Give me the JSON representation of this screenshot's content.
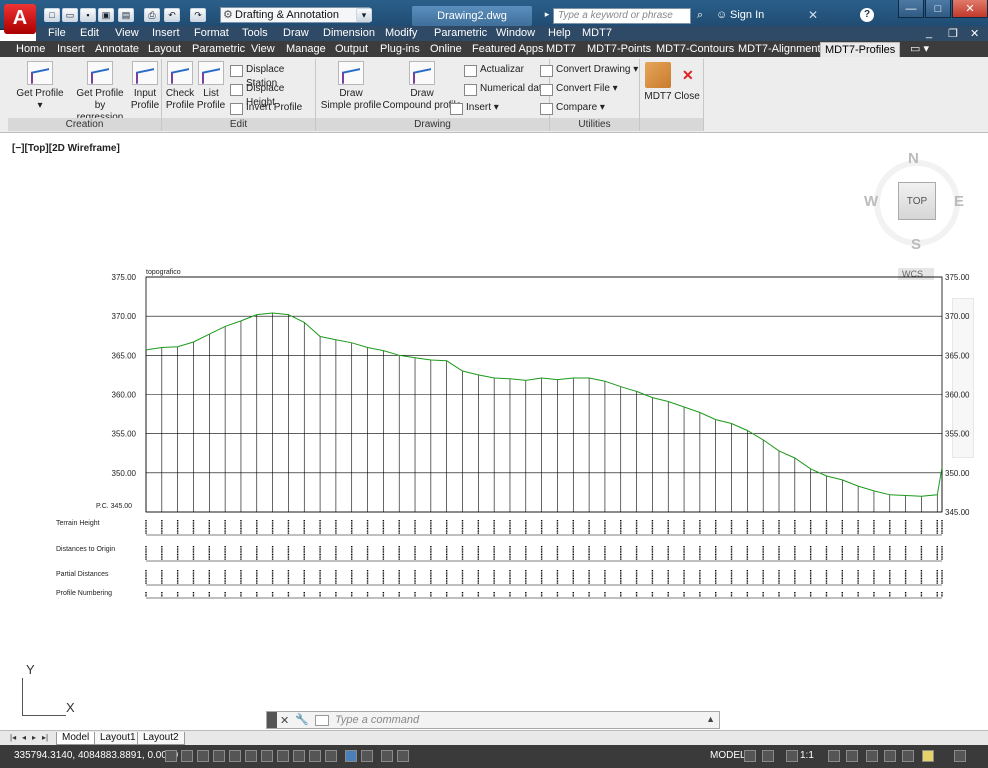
{
  "app": {
    "logo": "A",
    "workspace": "Drafting & Annotation",
    "document_title": "Drawing2.dwg",
    "search_placeholder": "Type a keyword or phrase",
    "sign_in": "Sign In"
  },
  "menu": [
    "File",
    "Edit",
    "View",
    "Insert",
    "Format",
    "Tools",
    "Draw",
    "Dimension",
    "Modify",
    "Parametric",
    "Window",
    "Help",
    "MDT7"
  ],
  "ribbon_tabs": [
    "Home",
    "Insert",
    "Annotate",
    "Layout",
    "Parametric",
    "View",
    "Manage",
    "Output",
    "Plug-ins",
    "Online",
    "Featured Apps",
    "MDT7",
    "MDT7-Points",
    "MDT7-Contours",
    "MDT7-Alignment",
    "MDT7-Profiles"
  ],
  "ribbon": {
    "creation": {
      "title": "Creation",
      "get_profile": "Get Profile",
      "get_profile_regression": [
        "Get Profile",
        "by regression"
      ],
      "input_profile": [
        "Input",
        "Profile"
      ]
    },
    "edit": {
      "title": "Edit",
      "check_profile": [
        "Check",
        "Profile"
      ],
      "list_profile": [
        "List",
        "Profile"
      ],
      "displace_station": "Displace Station",
      "displace_height": "Displace Height",
      "invert_profile": "Invert Profile"
    },
    "drawing": {
      "title": "Drawing",
      "draw_simple": [
        "Draw",
        "Simple profile"
      ],
      "draw_compound": [
        "Draw",
        "Compound profile"
      ],
      "actualizar": "Actualizar",
      "numerical_data": "Numerical data",
      "insert": "Insert"
    },
    "utilities": {
      "title": "Utilities",
      "convert_drawing": "Convert Drawing",
      "convert_file": "Convert File",
      "compare": "Compare"
    },
    "mdt7": {
      "label": "MDT7",
      "close": "Close"
    }
  },
  "viewport": {
    "label": "[−][Top][2D Wireframe]",
    "cube_top": "TOP",
    "north": "N",
    "south": "S",
    "east": "E",
    "west": "W",
    "wcs": "WCS"
  },
  "chart_data": {
    "type": "line",
    "title": "topografico",
    "y_ticks": [
      375.0,
      370.0,
      365.0,
      360.0,
      355.0,
      350.0,
      345.0
    ],
    "y_tick_labels": [
      "375.00",
      "370.00",
      "365.00",
      "360.00",
      "355.00",
      "350.00",
      "345.00"
    ],
    "ylim": [
      345,
      375
    ],
    "datum_label": "P.C. 345.00",
    "row_labels": [
      "Terrain Height",
      "Distances to Origin",
      "Partial Distances",
      "Profile Numbering"
    ],
    "x": [
      0,
      10,
      20,
      30,
      40,
      50,
      60,
      70,
      80,
      90,
      100,
      110,
      120,
      130,
      140,
      150,
      160,
      170,
      180,
      190,
      200,
      210,
      220,
      230,
      240,
      250,
      260,
      270,
      280,
      290,
      300,
      310,
      320,
      330,
      340,
      350,
      360,
      370,
      380,
      390,
      400,
      410,
      420,
      430,
      440,
      450,
      460,
      470,
      480,
      490,
      500,
      503
    ],
    "series": [
      {
        "values": [
          365.7,
          366.0,
          366.1,
          366.7,
          367.7,
          368.7,
          369.4,
          370.2,
          370.4,
          370.2,
          369.2,
          367.4,
          367.0,
          366.6,
          366.0,
          365.6,
          365.0,
          364.7,
          364.4,
          364.3,
          363.0,
          362.5,
          362.1,
          362.0,
          361.8,
          362.1,
          361.9,
          362.1,
          362.1,
          361.7,
          361.0,
          360.4,
          359.6,
          359.1,
          358.4,
          357.7,
          356.8,
          356.3,
          355.4,
          354.2,
          352.8,
          351.9,
          350.5,
          349.6,
          349.1,
          348.3,
          347.7,
          347.2,
          347.1,
          347.0,
          347.2,
          350.7
        ]
      }
    ]
  },
  "ucs": {
    "x": "X",
    "y": "Y"
  },
  "command": {
    "placeholder": "Type a command"
  },
  "layouts": [
    "Model",
    "Layout1",
    "Layout2"
  ],
  "status": {
    "coords": "335794.3140, 4084883.8891, 0.0000",
    "model": "MODEL",
    "scale": "1:1"
  }
}
